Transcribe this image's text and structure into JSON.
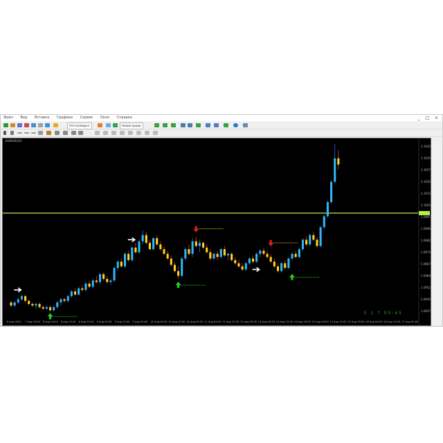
{
  "window": {
    "menu": [
      "Файл",
      "Вид",
      "Вставка",
      "Графики",
      "Сервис",
      "Окно",
      "Справка"
    ],
    "controls": "_ □ ×"
  },
  "toolbar": {
    "algo_label": "Алготрейдинг",
    "new_order_label": "Новый ордер"
  },
  "chart": {
    "symbol": "EURUSD,H1",
    "countdown": "5 1 7 05:45",
    "current_price_line": 1.1,
    "x_labels": [
      "6 Aug 2023",
      "7 Aug 20:00",
      "8 Aug 04:00",
      "8 Aug 12:00",
      "8 Aug 20:00",
      "9 Aug 04:00",
      "9 Aug 12:00",
      "9 Aug 20:00",
      "10 Aug 04:00",
      "10 Aug 12:00",
      "10 Aug 20:00",
      "11 Aug 04:00",
      "11 Aug 12:00",
      "11 Aug 20:00",
      "14 Aug 04:00",
      "14 Aug 12:00",
      "14 Aug 20:00",
      "15 Aug 04:00",
      "15 Aug 12:00",
      "15 Aug 20:00",
      "16 Aug 04:00",
      "16 Aug 12:00",
      "17 Aug 00:00"
    ],
    "y_labels": [
      "1.10425",
      "1.10350",
      "1.10275",
      "1.10200",
      "1.10125",
      "1.10050",
      "1.09975",
      "1.09900",
      "1.09825",
      "1.09750",
      "1.09675",
      "1.09600",
      "1.09525",
      "1.09450",
      "1.09375"
    ]
  },
  "chart_data": {
    "type": "bar",
    "ylim": [
      1.0935,
      1.1045
    ],
    "bullish_color": "#2fb7f5",
    "bearish_color": "#ffd21f",
    "candles": [
      [
        1.0943,
        1.0944,
        1.094,
        1.0941
      ],
      [
        1.0941,
        1.0944,
        1.094,
        1.0943
      ],
      [
        1.0943,
        1.0946,
        1.0942,
        1.0945
      ],
      [
        1.0945,
        1.0948,
        1.0944,
        1.0947
      ],
      [
        1.0947,
        1.0948,
        1.0943,
        1.0944
      ],
      [
        1.0944,
        1.0945,
        1.0941,
        1.0942
      ],
      [
        1.0942,
        1.0943,
        1.094,
        1.0941
      ],
      [
        1.0941,
        1.0943,
        1.0939,
        1.0942
      ],
      [
        1.0942,
        1.0943,
        1.0939,
        1.094
      ],
      [
        1.094,
        1.0941,
        1.0938,
        1.0939
      ],
      [
        1.0939,
        1.0941,
        1.0938,
        1.094
      ],
      [
        1.094,
        1.0941,
        1.0937,
        1.0938
      ],
      [
        1.0938,
        1.0941,
        1.0937,
        1.094
      ],
      [
        1.094,
        1.0944,
        1.0939,
        1.0943
      ],
      [
        1.0943,
        1.0946,
        1.0941,
        1.0945
      ],
      [
        1.0945,
        1.0946,
        1.0943,
        1.0944
      ],
      [
        1.0944,
        1.0948,
        1.0943,
        1.0947
      ],
      [
        1.0947,
        1.0951,
        1.0946,
        1.095
      ],
      [
        1.095,
        1.0952,
        1.0947,
        1.0948
      ],
      [
        1.0948,
        1.0953,
        1.0947,
        1.0952
      ],
      [
        1.0952,
        1.0954,
        1.095,
        1.0951
      ],
      [
        1.0951,
        1.0956,
        1.095,
        1.0955
      ],
      [
        1.0955,
        1.0957,
        1.0952,
        1.0953
      ],
      [
        1.0953,
        1.0958,
        1.0952,
        1.0957
      ],
      [
        1.0957,
        1.096,
        1.0955,
        1.0956
      ],
      [
        1.0956,
        1.0962,
        1.0955,
        1.0961
      ],
      [
        1.0961,
        1.0962,
        1.0957,
        1.0958
      ],
      [
        1.0958,
        1.096,
        1.0955,
        1.0956
      ],
      [
        1.0956,
        1.0958,
        1.0954,
        1.0957
      ],
      [
        1.0957,
        1.0966,
        1.0956,
        1.0965
      ],
      [
        1.0965,
        1.097,
        1.0963,
        1.0969
      ],
      [
        1.0969,
        1.0971,
        1.0965,
        1.0966
      ],
      [
        1.0966,
        1.0975,
        1.0965,
        1.0974
      ],
      [
        1.0974,
        1.0976,
        1.0969,
        1.097
      ],
      [
        1.097,
        1.0979,
        1.0969,
        1.0978
      ],
      [
        1.0978,
        1.0981,
        1.0974,
        1.0975
      ],
      [
        1.0975,
        1.0983,
        1.0974,
        1.0982
      ],
      [
        1.0982,
        1.0989,
        1.098,
        1.0986
      ],
      [
        1.0986,
        1.0988,
        1.098,
        1.0981
      ],
      [
        1.0981,
        1.0983,
        1.0976,
        1.0977
      ],
      [
        1.0977,
        1.0985,
        1.0976,
        1.0984
      ],
      [
        1.0984,
        1.0986,
        1.0979,
        1.098
      ],
      [
        1.098,
        1.0982,
        1.0976,
        1.0977
      ],
      [
        1.0977,
        1.0979,
        1.0973,
        1.0974
      ],
      [
        1.0974,
        1.0976,
        1.097,
        1.0971
      ],
      [
        1.0971,
        1.0973,
        1.0966,
        1.0967
      ],
      [
        1.0967,
        1.0969,
        1.0962,
        1.0963
      ],
      [
        1.0963,
        1.0966,
        1.0958,
        1.096
      ],
      [
        1.096,
        1.0972,
        1.0959,
        1.0971
      ],
      [
        1.0971,
        1.0978,
        1.097,
        1.0977
      ],
      [
        1.0977,
        1.098,
        1.0973,
        1.0974
      ],
      [
        1.0974,
        1.0984,
        1.0972,
        1.0982
      ],
      [
        1.0982,
        1.0985,
        1.0978,
        1.0979
      ],
      [
        1.0979,
        1.0983,
        1.0975,
        1.0981
      ],
      [
        1.0981,
        1.0982,
        1.0977,
        1.0978
      ],
      [
        1.0978,
        1.098,
        1.0974,
        1.0975
      ],
      [
        1.0975,
        1.0977,
        1.097,
        1.0971
      ],
      [
        1.0971,
        1.0975,
        1.097,
        1.0974
      ],
      [
        1.0974,
        1.0976,
        1.097,
        1.0972
      ],
      [
        1.0972,
        1.0978,
        1.0971,
        1.0977
      ],
      [
        1.0977,
        1.0979,
        1.0972,
        1.0973
      ],
      [
        1.0973,
        1.0975,
        1.097,
        1.0974
      ],
      [
        1.0974,
        1.0975,
        1.0969,
        1.097
      ],
      [
        1.097,
        1.0972,
        1.0967,
        1.0968
      ],
      [
        1.0968,
        1.097,
        1.0965,
        1.0966
      ],
      [
        1.0966,
        1.0968,
        1.0963,
        1.0964
      ],
      [
        1.0964,
        1.0969,
        1.0963,
        1.0968
      ],
      [
        1.0968,
        1.0972,
        1.0967,
        1.0971
      ],
      [
        1.0971,
        1.0973,
        1.0968,
        1.0969
      ],
      [
        1.0969,
        1.0975,
        1.0968,
        1.0974
      ],
      [
        1.0974,
        1.0977,
        1.0972,
        1.0976
      ],
      [
        1.0976,
        1.0978,
        1.0973,
        1.0974
      ],
      [
        1.0974,
        1.0976,
        1.0971,
        1.0972
      ],
      [
        1.0972,
        1.0974,
        1.0968,
        1.0969
      ],
      [
        1.0969,
        1.0971,
        1.0965,
        1.0966
      ],
      [
        1.0966,
        1.0968,
        1.0962,
        1.0963
      ],
      [
        1.0963,
        1.0969,
        1.0962,
        1.0968
      ],
      [
        1.0968,
        1.097,
        1.0964,
        1.0965
      ],
      [
        1.0965,
        1.0972,
        1.0964,
        1.0971
      ],
      [
        1.0971,
        1.0975,
        1.097,
        1.0974
      ],
      [
        1.0974,
        1.0976,
        1.0971,
        1.0972
      ],
      [
        1.0972,
        1.0978,
        1.0971,
        1.0977
      ],
      [
        1.0977,
        1.0984,
        1.0976,
        1.0983
      ],
      [
        1.0983,
        1.0985,
        1.0979,
        1.098
      ],
      [
        1.098,
        1.0987,
        1.0979,
        1.0986
      ],
      [
        1.0986,
        1.0988,
        1.0982,
        1.0983
      ],
      [
        1.0983,
        1.0985,
        1.0978,
        1.0979
      ],
      [
        1.0979,
        1.0992,
        1.0978,
        1.0991
      ],
      [
        1.0991,
        1.0999,
        1.099,
        1.0998
      ],
      [
        1.0998,
        1.1008,
        1.0997,
        1.1007
      ],
      [
        1.1007,
        1.1021,
        1.1006,
        1.102
      ],
      [
        1.102,
        1.1044,
        1.1019,
        1.1035
      ],
      [
        1.1035,
        1.104,
        1.1028,
        1.1031
      ]
    ],
    "signals": [
      {
        "index": 2,
        "type": "white-arrow",
        "price": 1.0951
      },
      {
        "index": 11,
        "type": "up-arrow",
        "price": 1.0934
      },
      {
        "index": 34,
        "type": "white-arrow",
        "price": 1.0983
      },
      {
        "index": 47,
        "type": "up-arrow",
        "price": 1.0954
      },
      {
        "index": 52,
        "type": "down-arrow",
        "price": 1.099
      },
      {
        "index": 69,
        "type": "white-arrow",
        "price": 1.0964
      },
      {
        "index": 73,
        "type": "down-arrow",
        "price": 1.0981
      },
      {
        "index": 79,
        "type": "up-arrow",
        "price": 1.0959
      }
    ]
  }
}
